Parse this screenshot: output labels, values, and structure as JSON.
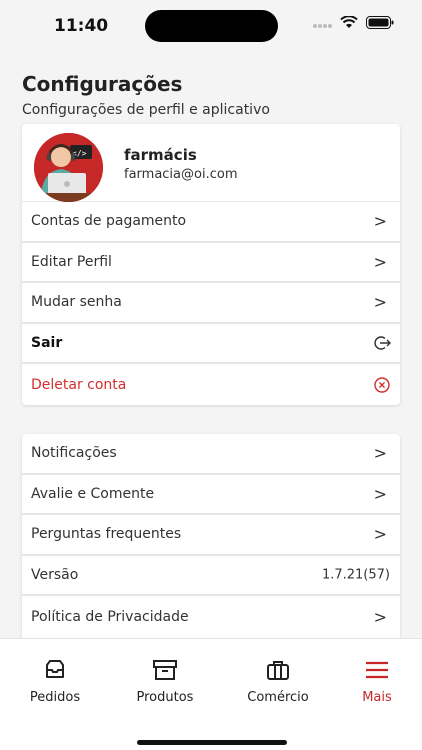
{
  "status": {
    "time": "11:40"
  },
  "header": {
    "title": "Configurações",
    "subtitle": "Configurações de perfil e aplicativo"
  },
  "profile": {
    "name": "farmácis",
    "email": "farmacia@oi.com"
  },
  "menu1": [
    {
      "label": "Contas de pagamento",
      "icon": "chevron-right-icon"
    },
    {
      "label": "Editar Perfil",
      "icon": "chevron-right-icon"
    },
    {
      "label": "Mudar senha",
      "icon": "chevron-right-icon"
    },
    {
      "label": "Sair",
      "icon": "logout-icon"
    },
    {
      "label": "Deletar conta",
      "icon": "delete-circle-icon"
    }
  ],
  "menu2": [
    {
      "label": "Notificações",
      "icon": "chevron-right-icon"
    },
    {
      "label": "Avalie e Comente",
      "icon": "chevron-right-icon"
    },
    {
      "label": "Perguntas frequentes",
      "icon": "chevron-right-icon"
    },
    {
      "label": "Versão",
      "value": "1.7.21(57)"
    },
    {
      "label": "Política de Privacidade",
      "icon": "chevron-right-icon"
    }
  ],
  "nav": {
    "items": [
      {
        "label": "Pedidos",
        "icon": "inbox-icon"
      },
      {
        "label": "Produtos",
        "icon": "archive-box-icon"
      },
      {
        "label": "Comércio",
        "icon": "briefcase-icon"
      },
      {
        "label": "Mais",
        "icon": "menu-icon",
        "active": true
      }
    ]
  },
  "colors": {
    "accent": "#c62828",
    "danger": "#d32f2f"
  }
}
